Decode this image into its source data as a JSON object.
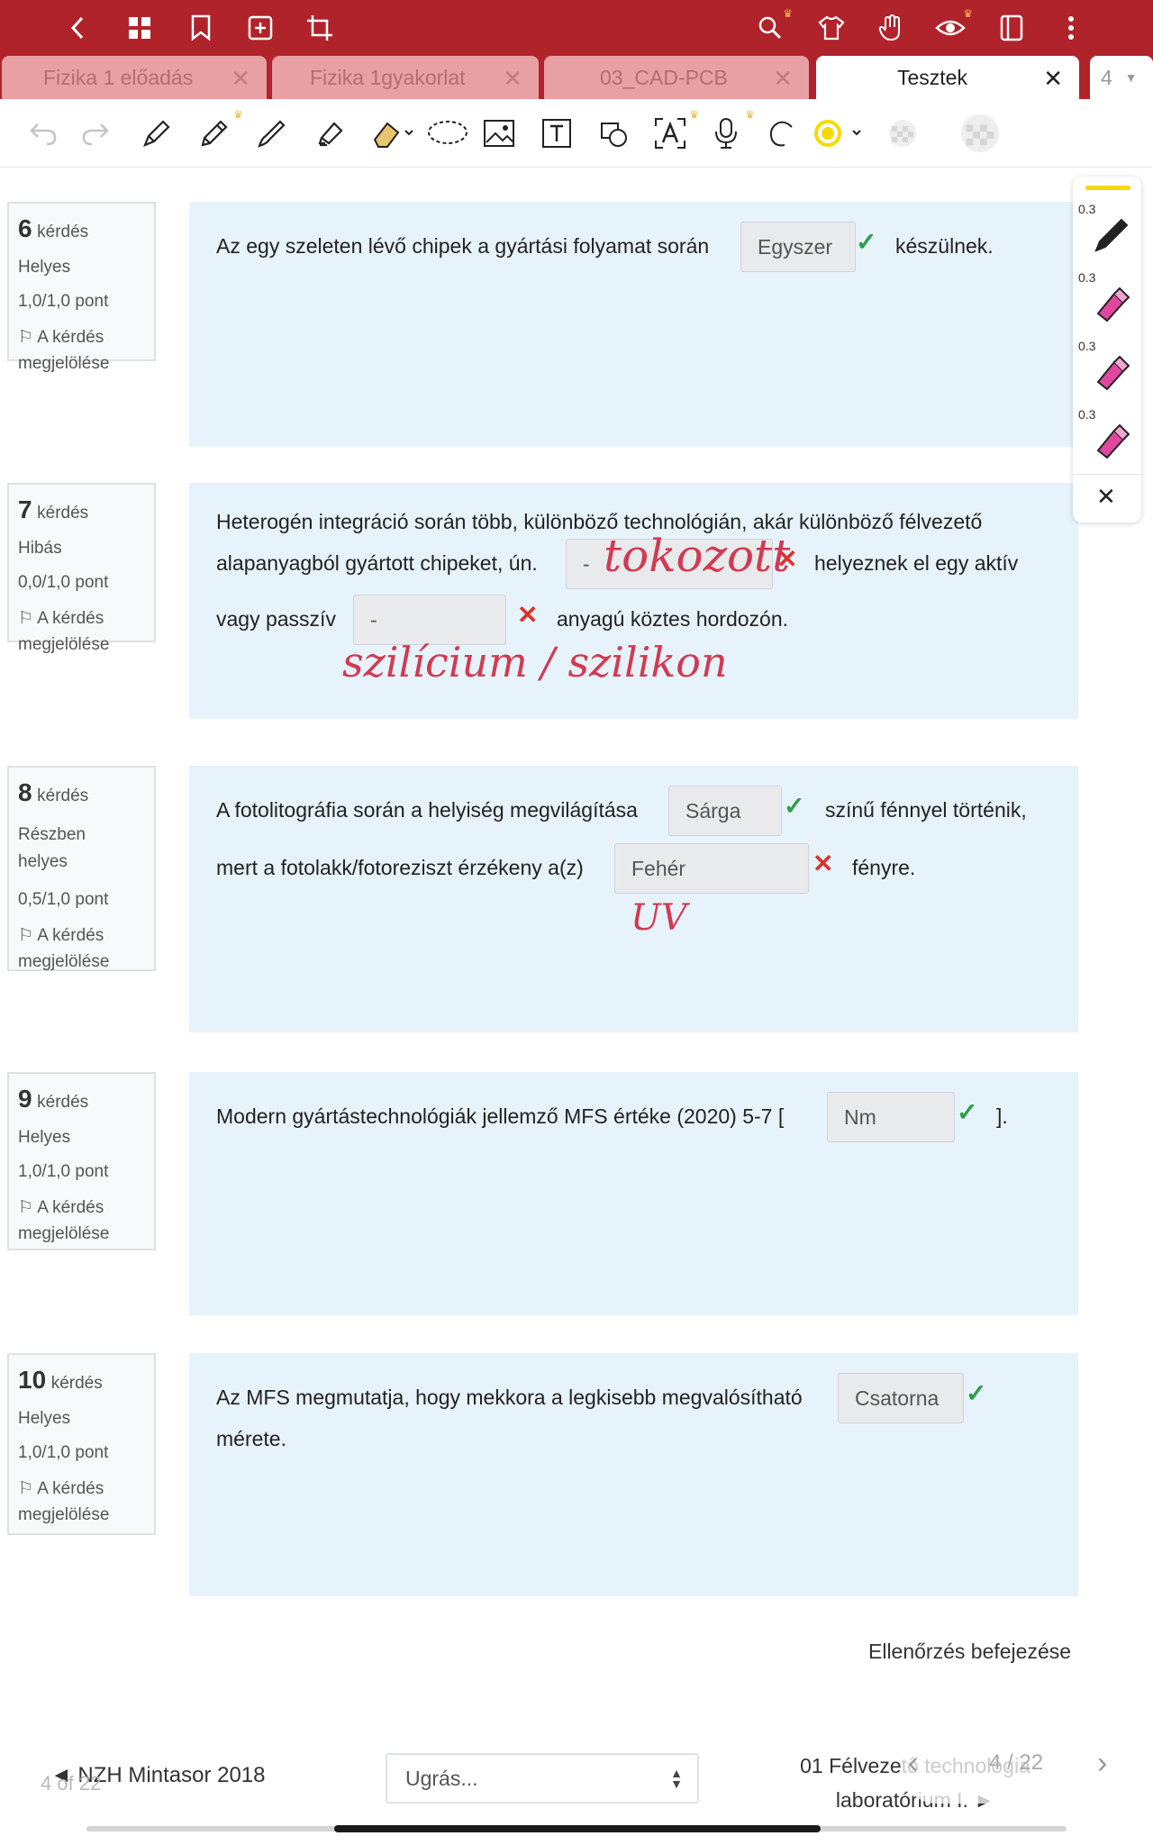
{
  "toolbar_top": {
    "icons": [
      "back-icon",
      "grid-icon",
      "bookmark-icon",
      "add-page-icon",
      "crop-icon",
      "search-icon",
      "shirt-icon",
      "hand-icon",
      "eye-icon",
      "notebook-icon",
      "more-icon"
    ]
  },
  "tabs": [
    {
      "label": "Fizika 1 előadás",
      "active": false
    },
    {
      "label": "Fizika 1gyakorlat",
      "active": false
    },
    {
      "label": "03_CAD-PCB",
      "active": false
    },
    {
      "label": "Tesztek",
      "active": true
    }
  ],
  "tab_overflow": "4",
  "pen_panel": {
    "sizes": [
      "0.3",
      "0.3",
      "0.3",
      "0.3"
    ],
    "active_color": "#f5d90a",
    "highlighter_color": "#e0479e"
  },
  "questions": [
    {
      "num": "6",
      "word": "kérdés",
      "status": "Helyes",
      "points": "1,0/1,0 pont",
      "flag": "A kérdés megjelölése",
      "text1": "Az egy szeleten lévő chipek a gyártási folyamat során",
      "answer1": "Egyszer",
      "text2": "készülnek."
    },
    {
      "num": "7",
      "word": "kérdés",
      "status": "Hibás",
      "points": "0,0/1,0 pont",
      "flag": "A kérdés megjelölése",
      "text1": "Heterogén integráció során több, különböző technológián, akár különböző félvezető",
      "text2": "alapanyagból gyártott chipeket, ún.",
      "answer1": "-",
      "text3": "helyeznek el egy aktív",
      "text4": "vagy passzív",
      "answer2": "-",
      "text5": "anyagú  köztes hordozón.",
      "hand1": "tokozott",
      "hand2": "szilícium / szilikon"
    },
    {
      "num": "8",
      "word": "kérdés",
      "status": "Részben helyes",
      "points": "0,5/1,0 pont",
      "flag": "A kérdés megjelölése",
      "text1": "A fotolitográfia során a helyiség megvilágítása",
      "answer1": "Sárga",
      "text2": "színű fénnyel történik,",
      "text3": "mert a fotolakk/fotoreziszt érzékeny a(z)",
      "answer2": "Fehér",
      "text4": "fényre.",
      "hand1": "UV"
    },
    {
      "num": "9",
      "word": "kérdés",
      "status": "Helyes",
      "points": "1,0/1,0 pont",
      "flag": "A kérdés megjelölése",
      "text1": "Modern gyártástechnológiák jellemző MFS értéke (2020) 5-7 [",
      "answer1": "Nm",
      "text2": "]."
    },
    {
      "num": "10",
      "word": "kérdés",
      "status": "Helyes",
      "points": "1,0/1,0 pont",
      "flag": "A kérdés megjelölése",
      "text1": "Az MFS megmutatja, hogy mekkora a legkisebb megvalósítható",
      "answer1": "Csatorna",
      "text2": "mérete."
    }
  ],
  "finish_link": "Ellenőrzés befejezése",
  "nav": {
    "prev": "◄ NZH Mintasor 2018",
    "jump": "Ugrás...",
    "next_line1": "01 Félvezető technológia",
    "next_line2": "laboratórium I. ►",
    "page_count": "4 of 22",
    "page_overlay": "4 / 22"
  }
}
